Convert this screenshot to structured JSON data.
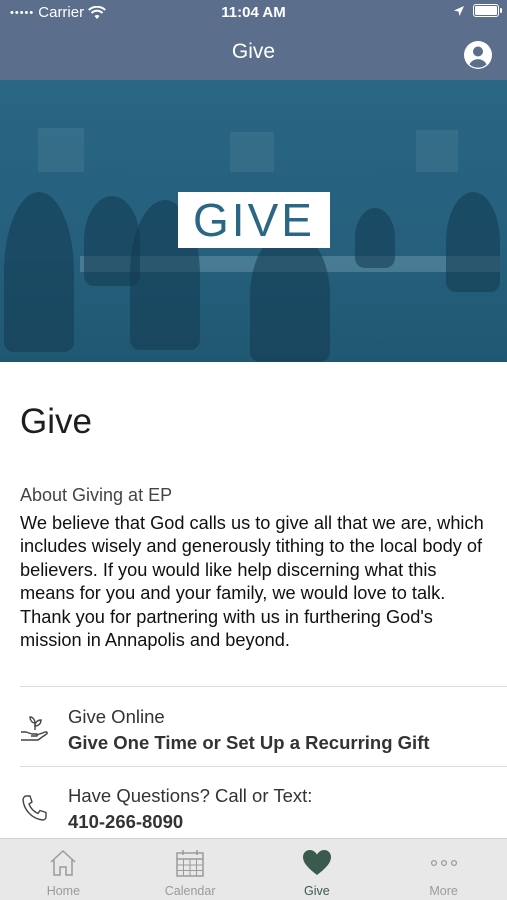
{
  "status_bar": {
    "carrier": "Carrier",
    "time": "11:04 AM"
  },
  "nav": {
    "title": "Give"
  },
  "hero": {
    "overlay_text": "GIVE"
  },
  "content": {
    "title": "Give",
    "section_label": "About Giving at EP",
    "body": "We believe that God calls us to give all that we are, which includes wisely and generously tithing to the local body of believers. If you would like help discerning what this means for you and your family, we would love to talk. Thank you for partnering with us in furthering God's mission in Annapolis and beyond."
  },
  "rows": [
    {
      "icon": "hand-plant-icon",
      "title": "Give Online",
      "subtitle": "Give One Time or Set Up a Recurring Gift"
    },
    {
      "icon": "phone-icon",
      "title": "Have Questions? Call or Text:",
      "subtitle": "410-266-8090"
    }
  ],
  "tabs": [
    {
      "icon": "home-icon",
      "label": "Home",
      "active": false
    },
    {
      "icon": "calendar-icon",
      "label": "Calendar",
      "active": false
    },
    {
      "icon": "heart-icon",
      "label": "Give",
      "active": true
    },
    {
      "icon": "more-icon",
      "label": "More",
      "active": false
    }
  ],
  "colors": {
    "header": "#5b6f8c",
    "hero_tint": "#2b6581",
    "accent_active": "#3a5a4d",
    "tabbar_bg": "#e8e8e8"
  }
}
